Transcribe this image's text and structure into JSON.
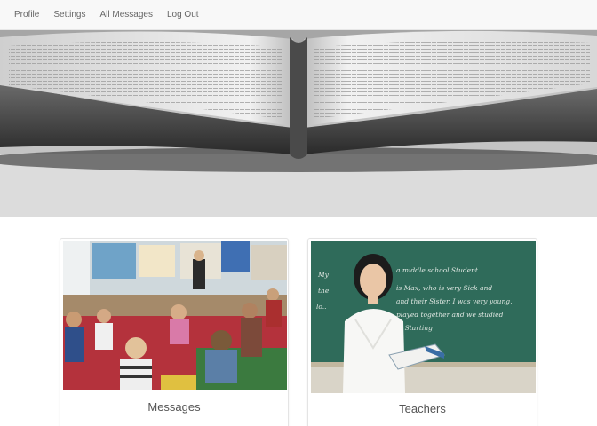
{
  "nav": {
    "items": [
      {
        "label": "Profile"
      },
      {
        "label": "Settings"
      },
      {
        "label": "All Messages"
      },
      {
        "label": "Log Out"
      }
    ]
  },
  "hero": {
    "image": "open-book-photo"
  },
  "cards": [
    {
      "caption": "Messages",
      "image": "classroom-photo"
    },
    {
      "caption": "Teachers",
      "image": "teacher-chalkboard-photo"
    }
  ],
  "chalkboard_text": [
    "a middle school Student.",
    "is Max, who is very Sick and",
    "and their Sister. I was very young,",
    "played together and we studied",
    "in Starting"
  ],
  "colors": {
    "navbar_bg": "#f8f8f8",
    "nav_text": "#666666",
    "chalkboard": "#2f6b5a",
    "card_border": "#e4e4e4"
  }
}
